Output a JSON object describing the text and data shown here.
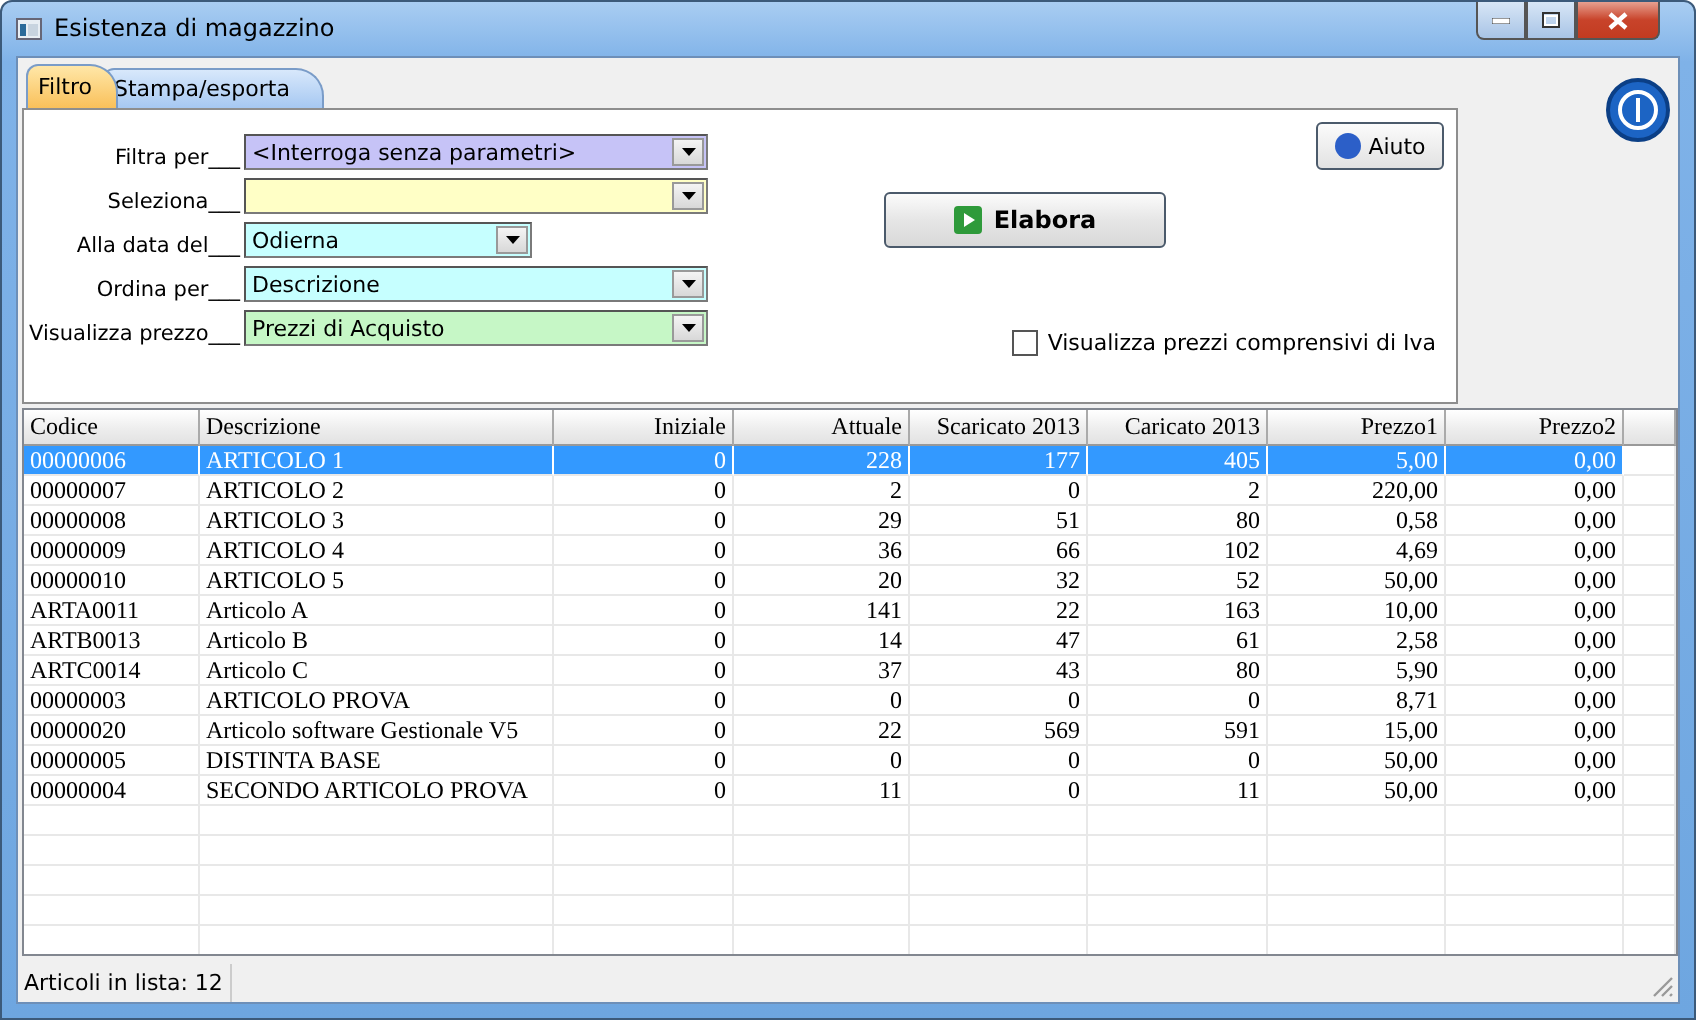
{
  "window": {
    "title": "Esistenza di magazzino"
  },
  "tabs": [
    {
      "label": "Filtro",
      "selected": true
    },
    {
      "label": "Stampa/esporta",
      "selected": false
    }
  ],
  "filters": [
    {
      "label": "Filtra per___",
      "value": "<Interroga senza parametri>",
      "color": "#c6c3f7"
    },
    {
      "label": "Seleziona___",
      "color": "#ffffc6"
    },
    {
      "label": "Alla data del___",
      "value": "Odierna",
      "color": "#c6ffff"
    },
    {
      "label": "Ordina per___",
      "value": "Descrizione",
      "color": "#c6ffff"
    },
    {
      "label": "Visualizza prezzo___",
      "value": "Prezzi di Acquisto",
      "color": "#c6f7c6"
    }
  ],
  "help_button": {
    "label": "Aiuto"
  },
  "run_button": {
    "label": "Elabora"
  },
  "vat_checkbox": {
    "label": "Visualizza prezzi comprensivi di Iva",
    "checked": false
  },
  "table": {
    "columns": [
      "Codice",
      "Descrizione",
      "Iniziale",
      "Attuale",
      "Scaricato 2013",
      "Caricato 2013",
      "Prezzo1",
      "Prezzo2"
    ],
    "rows": [
      {
        "cells": [
          "00000006",
          "ARTICOLO 1",
          "0",
          "228",
          "177",
          "405",
          "5,00",
          "0,00"
        ],
        "selected": true
      },
      {
        "cells": [
          "00000007",
          "ARTICOLO 2",
          "0",
          "2",
          "0",
          "2",
          "220,00",
          "0,00"
        ],
        "selected": false
      },
      {
        "cells": [
          "00000008",
          "ARTICOLO 3",
          "0",
          "29",
          "51",
          "80",
          "0,58",
          "0,00"
        ],
        "selected": false
      },
      {
        "cells": [
          "00000009",
          "ARTICOLO 4",
          "0",
          "36",
          "66",
          "102",
          "4,69",
          "0,00"
        ],
        "selected": false
      },
      {
        "cells": [
          "00000010",
          "ARTICOLO 5",
          "0",
          "20",
          "32",
          "52",
          "50,00",
          "0,00"
        ],
        "selected": false
      },
      {
        "cells": [
          "ARTA0011",
          "Articolo A",
          "0",
          "141",
          "22",
          "163",
          "10,00",
          "0,00"
        ],
        "selected": false
      },
      {
        "cells": [
          "ARTB0013",
          "Articolo B",
          "0",
          "14",
          "47",
          "61",
          "2,58",
          "0,00"
        ],
        "selected": false
      },
      {
        "cells": [
          "ARTC0014",
          "Articolo C",
          "0",
          "37",
          "43",
          "80",
          "5,90",
          "0,00"
        ],
        "selected": false
      },
      {
        "cells": [
          "00000003",
          "ARTICOLO PROVA",
          "0",
          "0",
          "0",
          "0",
          "8,71",
          "0,00"
        ],
        "selected": false
      },
      {
        "cells": [
          "00000020",
          "Articolo software Gestionale V5",
          "0",
          "22",
          "569",
          "591",
          "15,00",
          "0,00"
        ],
        "selected": false
      },
      {
        "cells": [
          "00000005",
          "DISTINTA BASE",
          "0",
          "0",
          "0",
          "0",
          "50,00",
          "0,00"
        ],
        "selected": false
      },
      {
        "cells": [
          "00000004",
          "SECONDO ARTICOLO PROVA",
          "0",
          "11",
          "0",
          "11",
          "50,00",
          "0,00"
        ],
        "selected": false
      }
    ]
  },
  "status_bar": {
    "text": "Articoli in lista: 12"
  }
}
